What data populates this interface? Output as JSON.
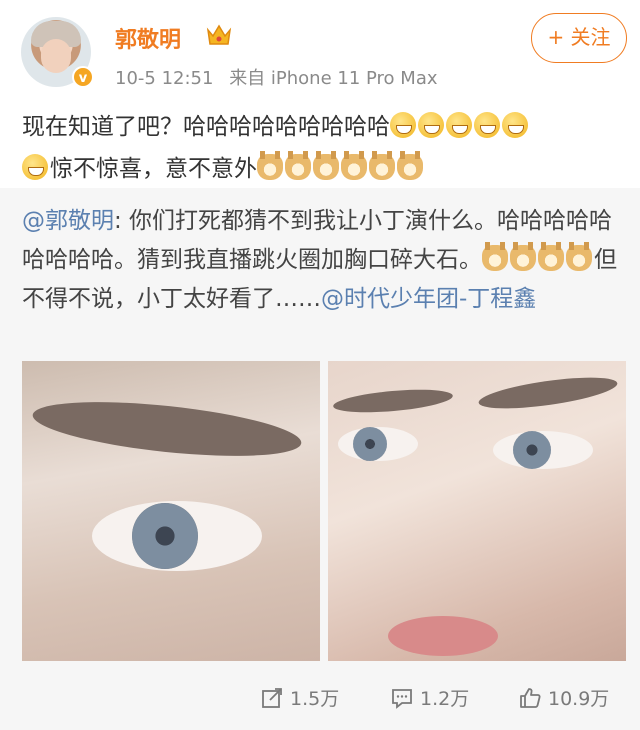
{
  "header": {
    "username": "郭敬明",
    "timestamp": "10-5 12:51",
    "source": "来自 iPhone 11 Pro Max",
    "follow_label": "+ 关注",
    "verified_badge": "v",
    "accent_color": "#f07c22"
  },
  "post": {
    "text_main": "现在知道了吧？哈哈哈哈哈哈哈哈哈",
    "text_second": "惊不惊喜，意不意外"
  },
  "repost": {
    "mention_author": "@郭敬明",
    "text_body": ": 你们打死都猜不到我让小丁演什么。哈哈哈哈哈哈哈哈哈。猜到我直播跳火圈加胸口碎大石。",
    "text_after_emoji": "但不得不说，小丁太好看了……",
    "mention_tag": "@时代少年团-丁程鑫"
  },
  "actions": {
    "share_count": "1.5万",
    "comment_count": "1.2万",
    "like_count": "10.9万"
  }
}
